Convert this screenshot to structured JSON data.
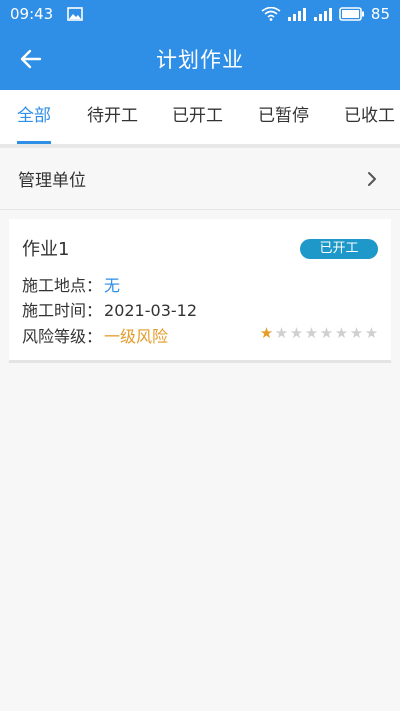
{
  "status": {
    "time": "09:43",
    "battery": "85"
  },
  "header": {
    "title": "计划作业"
  },
  "tabs": [
    {
      "label": "全部",
      "active": true
    },
    {
      "label": "待开工",
      "active": false
    },
    {
      "label": "已开工",
      "active": false
    },
    {
      "label": "已暂停",
      "active": false
    },
    {
      "label": "已收工",
      "active": false
    }
  ],
  "filter": {
    "label": "管理单位"
  },
  "cards": [
    {
      "name": "作业1",
      "status_badge": "已开工",
      "location_label": "施工地点：",
      "location_value": "无",
      "time_label": "施工时间：",
      "time_value": "2021-03-12",
      "risk_label": "风险等级：",
      "risk_value": "一级风险",
      "risk_rating": 1,
      "risk_rating_max": 8
    }
  ],
  "colors": {
    "primary": "#2f8ee6",
    "badge": "#1e97c9",
    "risk": "#e59b2a"
  }
}
